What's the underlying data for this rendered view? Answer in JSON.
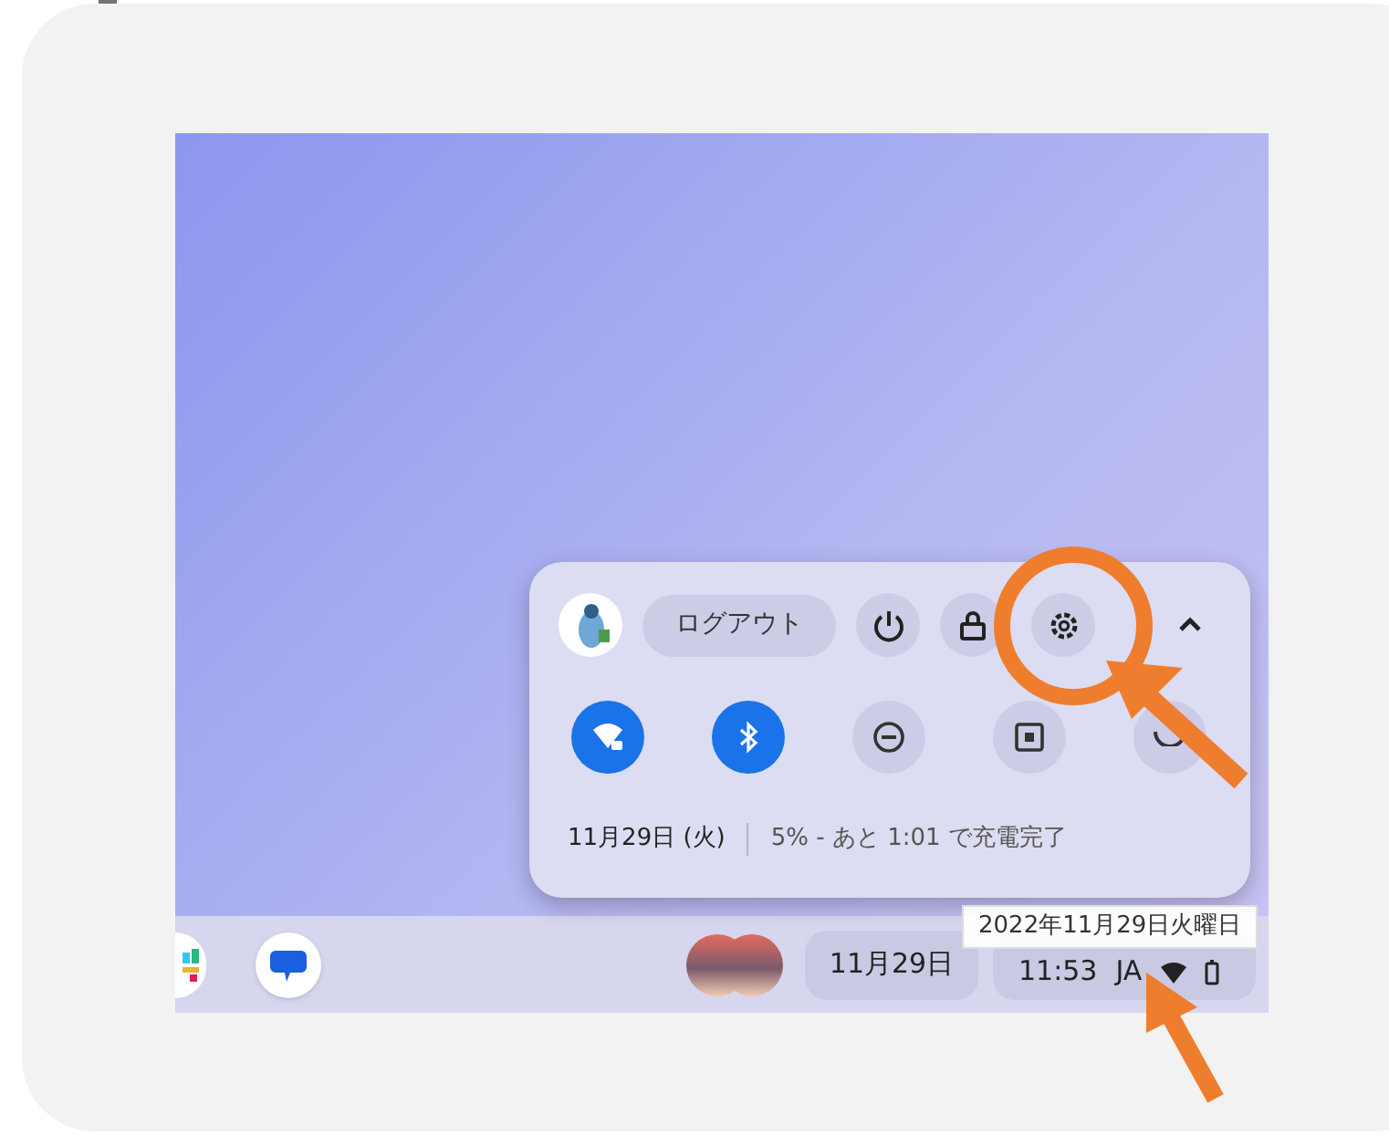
{
  "user_menu": {
    "logout_label": "ログアウト"
  },
  "toggles": [
    {
      "kind": "wifi",
      "on": true
    },
    {
      "kind": "bluetooth",
      "on": true
    },
    {
      "kind": "do-not-disturb",
      "on": false
    },
    {
      "kind": "screen-capture",
      "on": false
    },
    {
      "kind": "night-light",
      "on": false
    }
  ],
  "date": "11月29日 (火)",
  "battery_status": "5% - あと 1:01 で充電完了",
  "shelf": {
    "date": "11月29日",
    "time": "11:53",
    "ime": "JA"
  },
  "tooltip": "2022年11月29日火曜日"
}
